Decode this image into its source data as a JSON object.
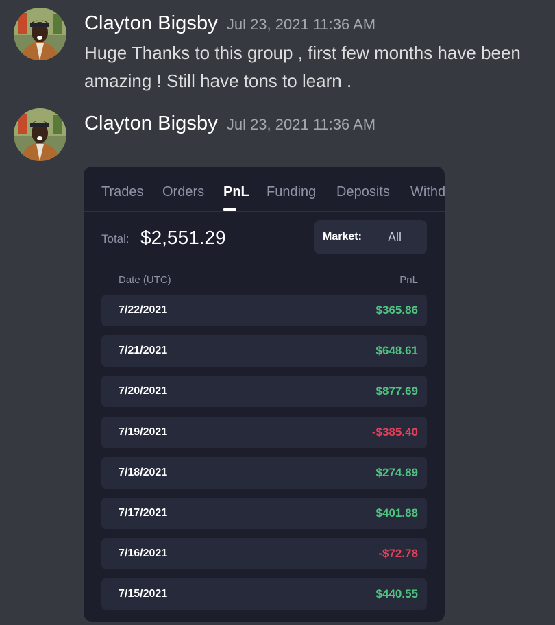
{
  "colors": {
    "background": "#36393f",
    "card_bg": "#1c1e2b",
    "row_bg": "#272a3a",
    "positive": "#4fc380",
    "negative": "#e0425c"
  },
  "messages": [
    {
      "author": "Clayton Bigsby",
      "timestamp": "Jul 23, 2021 11:36 AM",
      "text_line1": "Huge Thanks to this group , first few months have been",
      "text_line2": "amazing ! Still have tons to learn ."
    },
    {
      "author": "Clayton Bigsby",
      "timestamp": "Jul 23, 2021 11:36 AM"
    }
  ],
  "attachment": {
    "tabs": [
      "Trades",
      "Orders",
      "PnL",
      "Funding",
      "Deposits",
      "Withd"
    ],
    "active_tab": "PnL",
    "total_label": "Total:",
    "total_value": "$2,551.29",
    "market_label": "Market:",
    "market_value": "All",
    "columns": {
      "date": "Date (UTC)",
      "pnl": "PnL"
    },
    "rows": [
      {
        "date": "7/22/2021",
        "pnl": "$365.86",
        "sign": "positive"
      },
      {
        "date": "7/21/2021",
        "pnl": "$648.61",
        "sign": "positive"
      },
      {
        "date": "7/20/2021",
        "pnl": "$877.69",
        "sign": "positive"
      },
      {
        "date": "7/19/2021",
        "pnl": "-$385.40",
        "sign": "negative"
      },
      {
        "date": "7/18/2021",
        "pnl": "$274.89",
        "sign": "positive"
      },
      {
        "date": "7/17/2021",
        "pnl": "$401.88",
        "sign": "positive"
      },
      {
        "date": "7/16/2021",
        "pnl": "-$72.78",
        "sign": "negative"
      },
      {
        "date": "7/15/2021",
        "pnl": "$440.55",
        "sign": "positive"
      }
    ]
  }
}
